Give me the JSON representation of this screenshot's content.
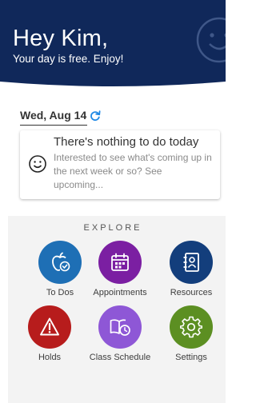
{
  "header": {
    "greeting": "Hey Kim,",
    "subtitle": "Your day is free. Enjoy!",
    "background_color": "#10285a",
    "watermark_icon": "smiley-face-icon"
  },
  "agenda": {
    "date": "Wed, Aug 14",
    "refresh_icon": "refresh-icon",
    "accent_color": "#1e88e5",
    "empty_state": {
      "icon": "smiley-face-icon",
      "title": "There's nothing to do today",
      "message": "Interested to see what's coming up in the next week or so? See upcoming..."
    }
  },
  "explore": {
    "title": "EXPLORE",
    "tiles": [
      {
        "label": "To Dos",
        "icon": "apple-check-icon",
        "color": "#1e6fb5"
      },
      {
        "label": "Appointments",
        "icon": "calendar-icon",
        "color": "#7b1fa2"
      },
      {
        "label": "Resources",
        "icon": "address-book-icon",
        "color": "#133e7c"
      },
      {
        "label": "Holds",
        "icon": "warning-icon",
        "color": "#b71c1c"
      },
      {
        "label": "Class Schedule",
        "icon": "book-clock-icon",
        "color": "#8e57d6"
      },
      {
        "label": "Settings",
        "icon": "gear-icon",
        "color": "#5c8f22"
      }
    ]
  }
}
